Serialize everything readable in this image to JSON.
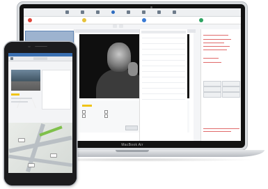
{
  "laptop": {
    "brand": "MacBook Air",
    "toolbar": [
      "",
      "",
      "",
      "",
      "",
      "",
      "",
      ""
    ],
    "steps": [
      {
        "label": "",
        "color": "#e0463a"
      },
      {
        "label": "",
        "color": "#e6c23a"
      },
      {
        "label": "",
        "color": "#3a7bd5"
      },
      {
        "label": "",
        "color": "#2fa463"
      }
    ],
    "tabs": [
      "",
      ""
    ],
    "alerts": [
      "",
      "",
      "",
      "",
      "",
      "",
      "",
      ""
    ],
    "buttons": [
      "",
      "",
      "",
      "",
      "",
      ""
    ],
    "form_checks": [
      "",
      "",
      "",
      ""
    ]
  },
  "phone": {
    "rows": [
      "",
      "",
      "",
      ""
    ]
  },
  "colors": {
    "accent_blue": "#3a6fb1",
    "alert_red": "#d0021b",
    "route_green": "#7fc04b"
  }
}
